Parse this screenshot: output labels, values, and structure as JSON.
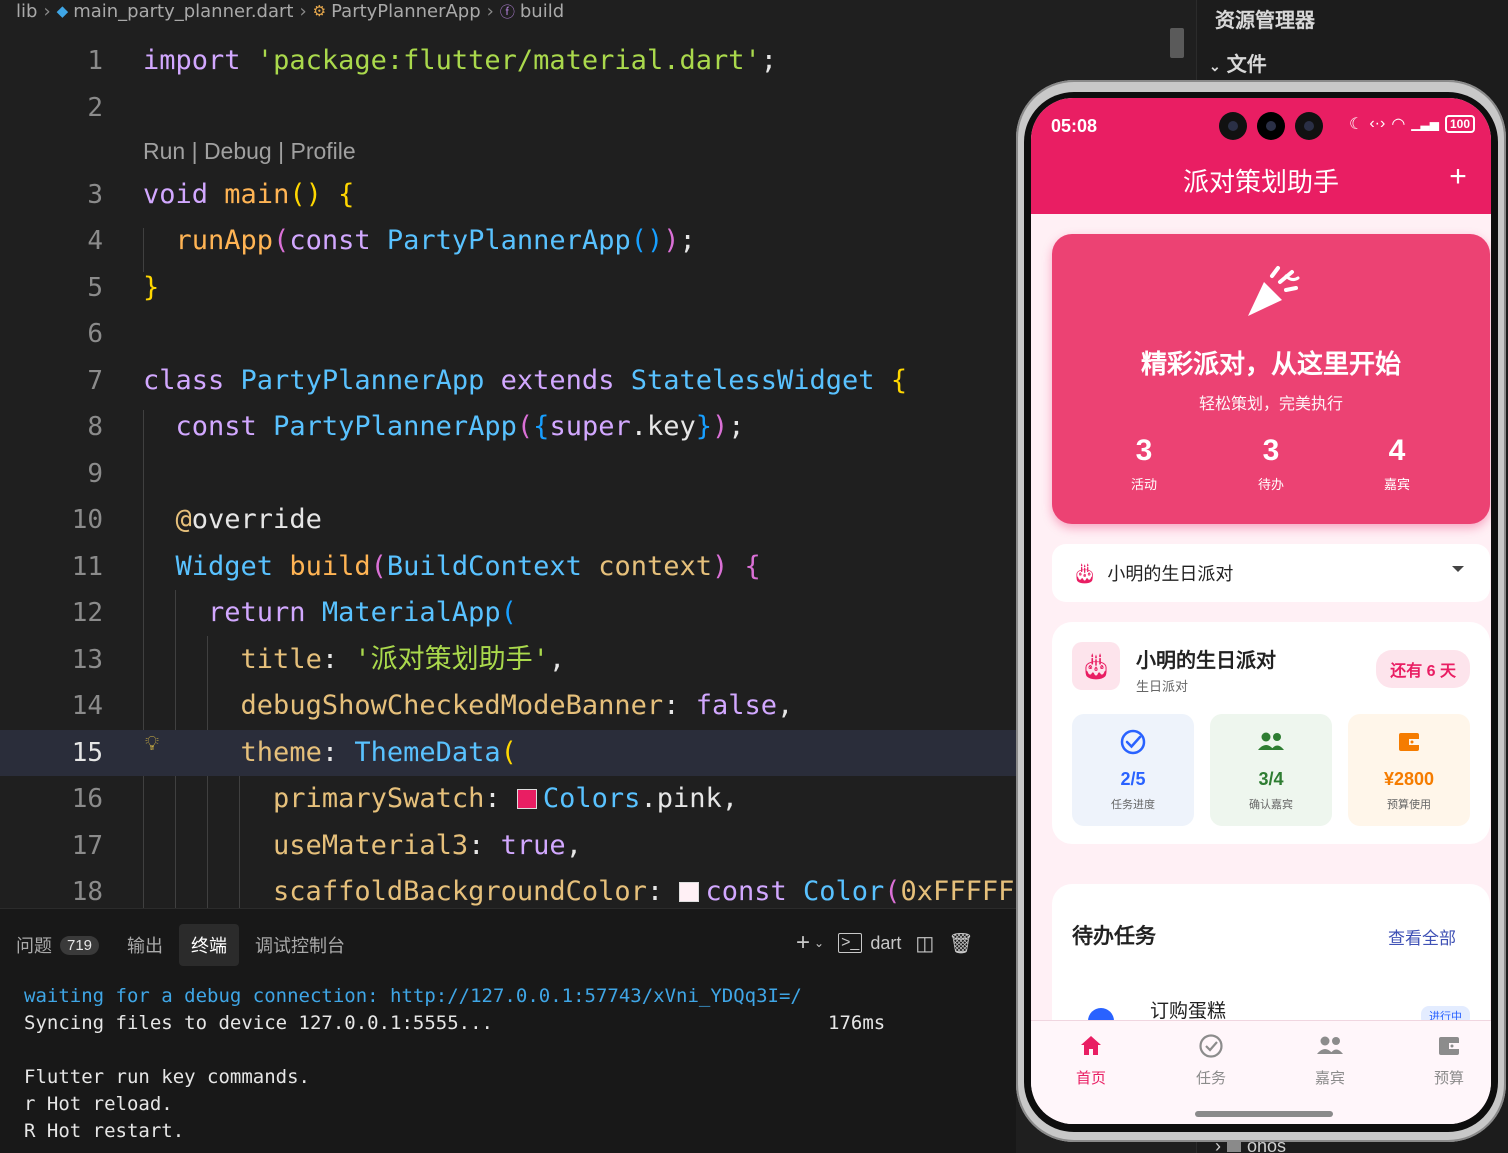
{
  "breadcrumb": {
    "items": [
      "lib",
      "main_party_planner.dart",
      "PartyPlannerApp",
      "build"
    ]
  },
  "editor": {
    "codelens": "Run | Debug | Profile",
    "line_numbers": [
      "1",
      "2",
      "3",
      "4",
      "5",
      "6",
      "7",
      "8",
      "9",
      "10",
      "11",
      "12",
      "13",
      "14",
      "15",
      "16",
      "17",
      "18"
    ],
    "active_line": "15"
  },
  "panel": {
    "tabs": [
      {
        "label": "问题",
        "count": "719"
      },
      {
        "label": "输出"
      },
      {
        "label": "终端"
      },
      {
        "label": "调试控制台"
      }
    ],
    "terminal_shell": "dart",
    "terminal": {
      "line1_prefix": "waiting for a debug connection: ",
      "line1_link": "http://127.0.0.1:57743/xVni_YDQq3I=/",
      "line2": "Syncing files to device 127.0.0.1:5555...",
      "line2_time": "176ms",
      "line3": "Flutter run key commands.",
      "line4": "r Hot reload.",
      "line5": "R Hot restart."
    }
  },
  "explorer": {
    "title": "资源管理器",
    "section": "文件",
    "folder": "ohos"
  },
  "phone": {
    "status_time": "05:08",
    "battery": "100",
    "app_title": "派对策划助手",
    "hero": {
      "title": "精彩派对，从这里开始",
      "subtitle": "轻松策划，完美执行",
      "stats": [
        {
          "value": "3",
          "label": "活动"
        },
        {
          "value": "3",
          "label": "待办"
        },
        {
          "value": "4",
          "label": "嘉宾"
        }
      ]
    },
    "selected_event": "小明的生日派对",
    "event": {
      "name": "小明的生日派对",
      "type": "生日派对",
      "days_left": "还有 6 天",
      "stats": [
        {
          "value": "2/5",
          "label": "任务进度",
          "color": "#2962ff",
          "bg": "#eef3fb"
        },
        {
          "value": "3/4",
          "label": "确认嘉宾",
          "color": "#2e7d32",
          "bg": "#eef6ee"
        },
        {
          "value": "¥2800",
          "label": "预算使用",
          "color": "#f57c00",
          "bg": "#fff6ea"
        }
      ]
    },
    "tasks": {
      "title": "待办任务",
      "view_all": "查看全部",
      "first_task": "订购蛋糕",
      "first_tag": "进行中"
    },
    "nav": [
      {
        "label": "首页",
        "icon": "home-icon"
      },
      {
        "label": "任务",
        "icon": "task-check-icon"
      },
      {
        "label": "嘉宾",
        "icon": "guests-icon"
      },
      {
        "label": "预算",
        "icon": "wallet-icon"
      }
    ],
    "accent": "#e91e63"
  }
}
